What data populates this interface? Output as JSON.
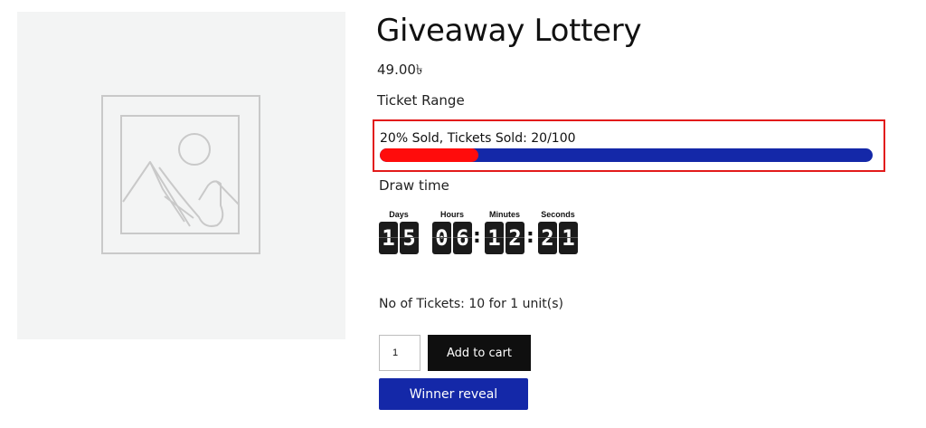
{
  "product": {
    "title": "Giveaway Lottery",
    "price": "49.00৳",
    "ticket_range_label": "Ticket Range",
    "image_placeholder_icon": "image-placeholder-icon"
  },
  "progress": {
    "text": "20% Sold, Tickets Sold: 20/100",
    "sold_fraction": 0.2,
    "fill_color": "#ff0c0c",
    "track_color": "#1428a8",
    "highlight_border_color": "#e21b1b"
  },
  "draw_time": {
    "label": "Draw time",
    "units": [
      {
        "label": "Days",
        "digits": [
          "1",
          "5"
        ]
      },
      {
        "label": "Hours",
        "digits": [
          "0",
          "6"
        ]
      },
      {
        "label": "Minutes",
        "digits": [
          "1",
          "2"
        ]
      },
      {
        "label": "Seconds",
        "digits": [
          "2",
          "1"
        ]
      }
    ],
    "separator": ":"
  },
  "tickets_info": "No of Tickets: 10 for 1 unit(s)",
  "cart": {
    "quantity": "1",
    "add_to_cart_label": "Add to cart",
    "button_color": "#0f0f0f"
  },
  "winner_reveal_label": "Winner reveal",
  "accent_color": "#1428a8"
}
